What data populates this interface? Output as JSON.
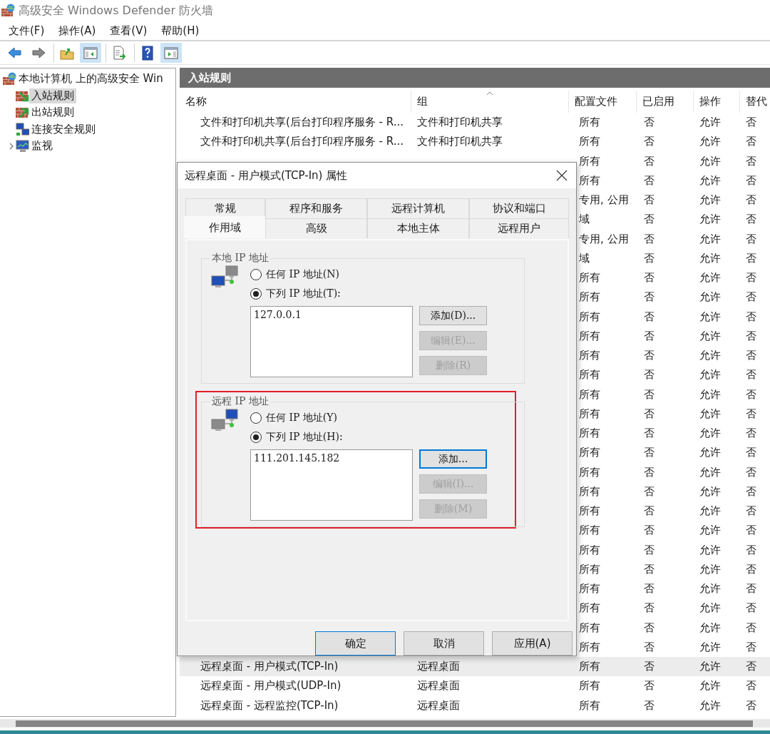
{
  "window": {
    "title": "高级安全 Windows Defender 防火墙"
  },
  "menu": [
    "文件(F)",
    "操作(A)",
    "查看(V)",
    "帮助(H)"
  ],
  "toolbar": [
    [
      {
        "kind": "back",
        "pressed": false
      },
      {
        "kind": "forward",
        "pressed": false
      }
    ],
    [
      {
        "kind": "up",
        "pressed": false
      },
      {
        "kind": "console-tree",
        "pressed": true
      }
    ],
    [
      {
        "kind": "export",
        "pressed": false
      }
    ],
    [
      {
        "kind": "help",
        "pressed": false
      },
      {
        "kind": "action-pane",
        "pressed": true
      }
    ]
  ],
  "tree": {
    "label": "本地计算机 上的高级安全 Win",
    "kind": "firewall",
    "selected": false,
    "children": [
      {
        "label": "入站规则",
        "kind": "inbound",
        "selected": true,
        "collapsed": false
      },
      {
        "label": "出站规则",
        "kind": "outbound",
        "selected": false,
        "collapsed": false
      },
      {
        "label": "连接安全规则",
        "kind": "security",
        "selected": false,
        "collapsed": false
      },
      {
        "label": "监视",
        "kind": "monitor",
        "selected": false,
        "collapsed": true
      }
    ]
  },
  "panel_title": "入站规则",
  "table": {
    "columns": [
      {
        "label": "名称",
        "sorted": false
      },
      {
        "label": "组",
        "sorted": true
      },
      {
        "label": "配置文件",
        "sorted": false
      },
      {
        "label": "已启用",
        "sorted": false
      },
      {
        "label": "操作",
        "sorted": false
      },
      {
        "label": "替代",
        "sorted": false
      }
    ],
    "rows": [
      {
        "name": "文件和打印机共享(后台打印程序服务 - R...",
        "group": "文件和打印机共享",
        "profile": "所有",
        "enabled": "否",
        "action": "允许",
        "override": "否",
        "selected": false
      },
      {
        "name": "文件和打印机共享(后台打印程序服务 - R...",
        "group": "文件和打印机共享",
        "profile": "所有",
        "enabled": "否",
        "action": "允许",
        "override": "否",
        "selected": false
      },
      {
        "profile": "所有",
        "enabled": "否",
        "action": "允许",
        "override": "否",
        "selected": false
      },
      {
        "profile": "所有",
        "enabled": "否",
        "action": "允许",
        "override": "否",
        "selected": false
      },
      {
        "profile": "专用, 公用",
        "enabled": "否",
        "action": "允许",
        "override": "否",
        "selected": false
      },
      {
        "profile": "域",
        "enabled": "否",
        "action": "允许",
        "override": "否",
        "selected": false
      },
      {
        "profile": "专用, 公用",
        "enabled": "否",
        "action": "允许",
        "override": "否",
        "selected": false
      },
      {
        "profile": "域",
        "enabled": "否",
        "action": "允许",
        "override": "否",
        "selected": false
      },
      {
        "profile": "所有",
        "enabled": "否",
        "action": "允许",
        "override": "否",
        "selected": false
      },
      {
        "profile": "所有",
        "enabled": "否",
        "action": "允许",
        "override": "否",
        "selected": false
      },
      {
        "profile": "所有",
        "enabled": "否",
        "action": "允许",
        "override": "否",
        "selected": false
      },
      {
        "profile": "所有",
        "enabled": "否",
        "action": "允许",
        "override": "否",
        "selected": false
      },
      {
        "profile": "所有",
        "enabled": "否",
        "action": "允许",
        "override": "否",
        "selected": false
      },
      {
        "profile": "所有",
        "enabled": "否",
        "action": "允许",
        "override": "否",
        "selected": false
      },
      {
        "profile": "所有",
        "enabled": "否",
        "action": "允许",
        "override": "否",
        "selected": false
      },
      {
        "profile": "所有",
        "enabled": "否",
        "action": "允许",
        "override": "否",
        "selected": false
      },
      {
        "profile": "所有",
        "enabled": "否",
        "action": "允许",
        "override": "否",
        "selected": false
      },
      {
        "profile": "所有",
        "enabled": "否",
        "action": "允许",
        "override": "否",
        "selected": false
      },
      {
        "profile": "所有",
        "enabled": "否",
        "action": "允许",
        "override": "否",
        "selected": false
      },
      {
        "profile": "所有",
        "enabled": "否",
        "action": "允许",
        "override": "否",
        "selected": false
      },
      {
        "profile": "所有",
        "enabled": "否",
        "action": "允许",
        "override": "否",
        "selected": false
      },
      {
        "profile": "所有",
        "enabled": "否",
        "action": "允许",
        "override": "否",
        "selected": false
      },
      {
        "profile": "所有",
        "enabled": "否",
        "action": "允许",
        "override": "否",
        "selected": false
      },
      {
        "profile": "所有",
        "enabled": "否",
        "action": "允许",
        "override": "否",
        "selected": false
      },
      {
        "profile": "所有",
        "enabled": "否",
        "action": "允许",
        "override": "否",
        "selected": false
      },
      {
        "profile": "所有",
        "enabled": "否",
        "action": "允许",
        "override": "否",
        "selected": false
      },
      {
        "profile": "所有",
        "enabled": "否",
        "action": "允许",
        "override": "否",
        "selected": false
      },
      {
        "profile": "所有",
        "enabled": "否",
        "action": "允许",
        "override": "否",
        "selected": false
      },
      {
        "name": "远程桌面 - 用户模式(TCP-In)",
        "group": "远程桌面",
        "profile": "所有",
        "enabled": "否",
        "action": "允许",
        "override": "否",
        "selected": true
      },
      {
        "name": "远程桌面 - 用户模式(UDP-In)",
        "group": "远程桌面",
        "profile": "所有",
        "enabled": "否",
        "action": "允许",
        "override": "否",
        "selected": false
      },
      {
        "name": "远程桌面 - 远程监控(TCP-In)",
        "group": "远程桌面",
        "profile": "所有",
        "enabled": "否",
        "action": "允许",
        "override": "否",
        "selected": false
      }
    ]
  },
  "dialog": {
    "title": "远程桌面 - 用户模式(TCP-In) 属性",
    "tab_rows": [
      [
        {
          "label": "常规",
          "selected": false
        },
        {
          "label": "程序和服务",
          "selected": false
        },
        {
          "label": "远程计算机",
          "selected": false
        },
        {
          "label": "协议和端口",
          "selected": false
        }
      ],
      [
        {
          "label": "作用域",
          "selected": true
        },
        {
          "label": "高级",
          "selected": false
        },
        {
          "label": "本地主体",
          "selected": false
        },
        {
          "label": "远程用户",
          "selected": false
        }
      ]
    ],
    "sections": [
      {
        "legend": "本地 IP 地址",
        "kind": "local",
        "highlighted": false,
        "options": [
          {
            "label": "任何 IP 地址(N)",
            "selected": false
          },
          {
            "label": "下列 IP 地址(T):",
            "selected": true
          }
        ],
        "addresses": [
          "127.0.0.1"
        ],
        "buttons": [
          {
            "label": "添加(D)...",
            "disabled": false,
            "focused": false
          },
          {
            "label": "编辑(E)...",
            "disabled": true,
            "focused": false
          },
          {
            "label": "删除(R)",
            "disabled": true,
            "focused": false
          }
        ]
      },
      {
        "legend": "远程 IP 地址",
        "kind": "remote",
        "highlighted": true,
        "options": [
          {
            "label": "任何 IP 地址(Y)",
            "selected": false
          },
          {
            "label": "下列 IP 地址(H):",
            "selected": true
          }
        ],
        "addresses": [
          "111.201.145.182"
        ],
        "buttons": [
          {
            "label": "添加...",
            "disabled": false,
            "focused": true
          },
          {
            "label": "编辑(I)...",
            "disabled": true,
            "focused": false
          },
          {
            "label": "删除(M)",
            "disabled": true,
            "focused": false
          }
        ]
      }
    ],
    "buttons": [
      {
        "label": "确定",
        "default": true
      },
      {
        "label": "取消",
        "default": false
      },
      {
        "label": "应用(A)",
        "default": false
      }
    ]
  }
}
